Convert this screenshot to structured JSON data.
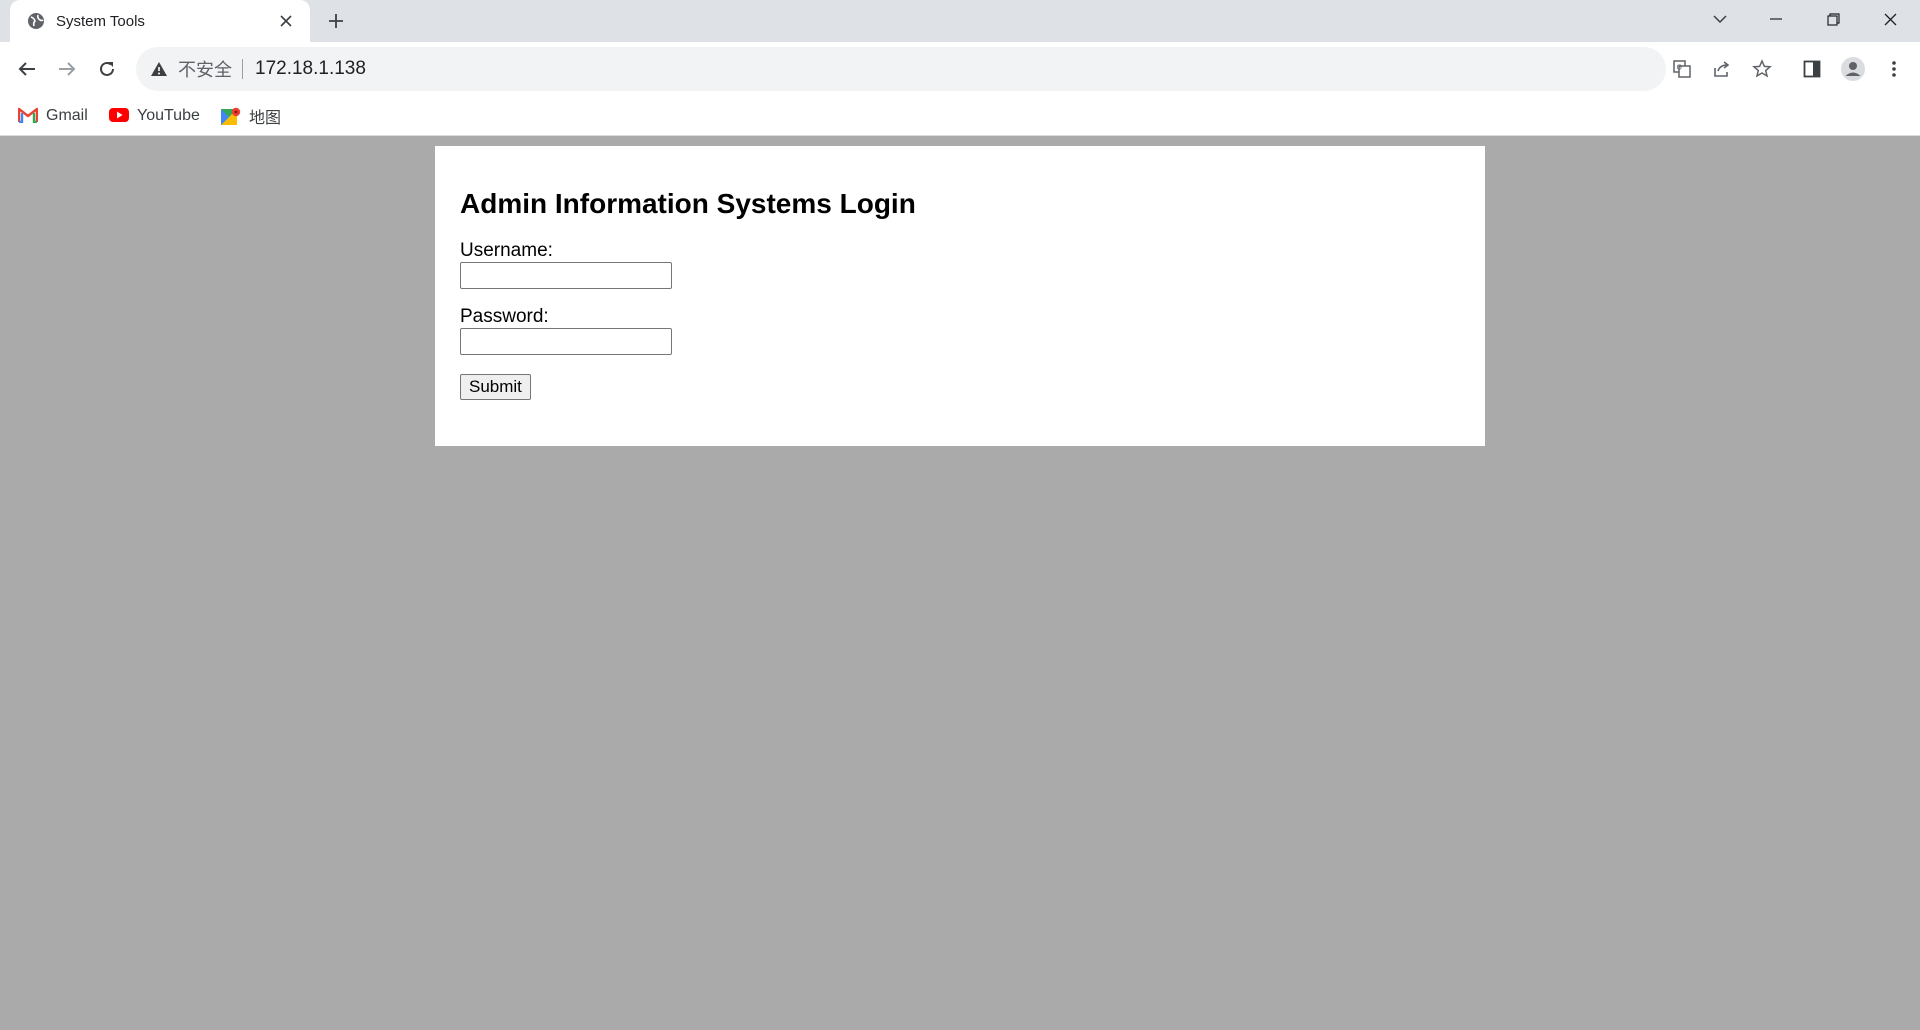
{
  "browser": {
    "tab": {
      "title": "System Tools"
    },
    "address_bar": {
      "security_label": "不安全",
      "url": "172.18.1.138"
    },
    "bookmarks": [
      {
        "label": "Gmail",
        "icon": "gmail-icon"
      },
      {
        "label": "YouTube",
        "icon": "youtube-icon"
      },
      {
        "label": "地图",
        "icon": "maps-icon"
      }
    ]
  },
  "page": {
    "heading": "Admin Information Systems Login",
    "username_label": "Username:",
    "username_value": "",
    "password_label": "Password:",
    "password_value": "",
    "submit_label": "Submit"
  },
  "colors": {
    "page_background": "#aaaaaa",
    "card_background": "#ffffff",
    "tabstrip": "#dee1e6",
    "omnibox": "#f1f3f4"
  }
}
